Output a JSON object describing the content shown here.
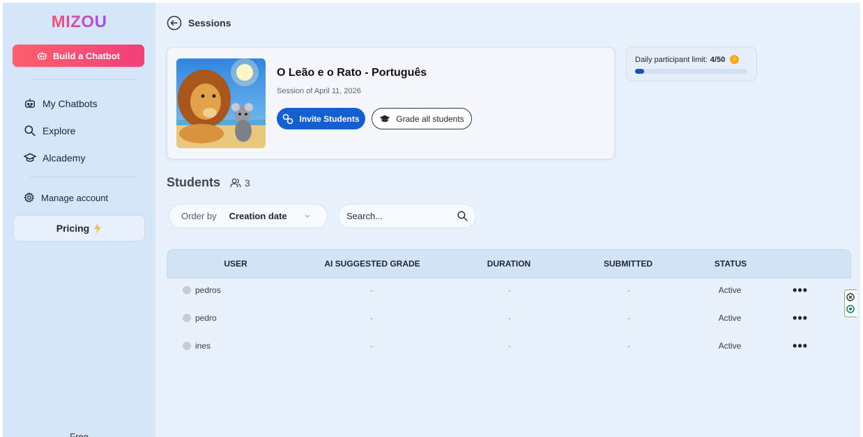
{
  "sidebar": {
    "logo": "MIZOU",
    "build_button": "Build a Chatbot",
    "nav": [
      {
        "label": "My Chatbots",
        "icon": "bot-icon"
      },
      {
        "label": "Explore",
        "icon": "search-icon"
      },
      {
        "label": "Alcademy",
        "icon": "graduation-cap-icon"
      }
    ],
    "manage_account": "Manage account",
    "pricing": "Pricing",
    "plan": "Free"
  },
  "header": {
    "back_label": "Sessions"
  },
  "session": {
    "title": "O Leão e o Rato - Português",
    "date": "Session of April 11, 2026",
    "invite_button": "Invite Students",
    "grade_button": "Grade all students"
  },
  "limit": {
    "label": "Daily participant limit:",
    "value": "4/50",
    "fraction": 0.08
  },
  "students": {
    "heading": "Students",
    "count": "3"
  },
  "filters": {
    "order_label": "Order by",
    "order_value": "Creation date",
    "search_placeholder": "Search..."
  },
  "table": {
    "columns": [
      "USER",
      "AI SUGGESTED GRADE",
      "DURATION",
      "SUBMITTED",
      "STATUS"
    ],
    "rows": [
      {
        "user": "pedros",
        "grade": "-",
        "duration": "-",
        "submitted": "-",
        "status": "Active"
      },
      {
        "user": "pedro",
        "grade": "-",
        "duration": "-",
        "submitted": "-",
        "status": "Active"
      },
      {
        "user": "ines",
        "grade": "-",
        "duration": "-",
        "submitted": "-",
        "status": "Active"
      }
    ]
  },
  "colors": {
    "primary": "#1460d0",
    "build_gradient_start": "#ff5f6d",
    "build_gradient_end": "#f0407a",
    "pricing_bolt": "#f5a623",
    "sidebar_bg": "#d6e6fa",
    "main_bg": "#e9f1fc"
  }
}
